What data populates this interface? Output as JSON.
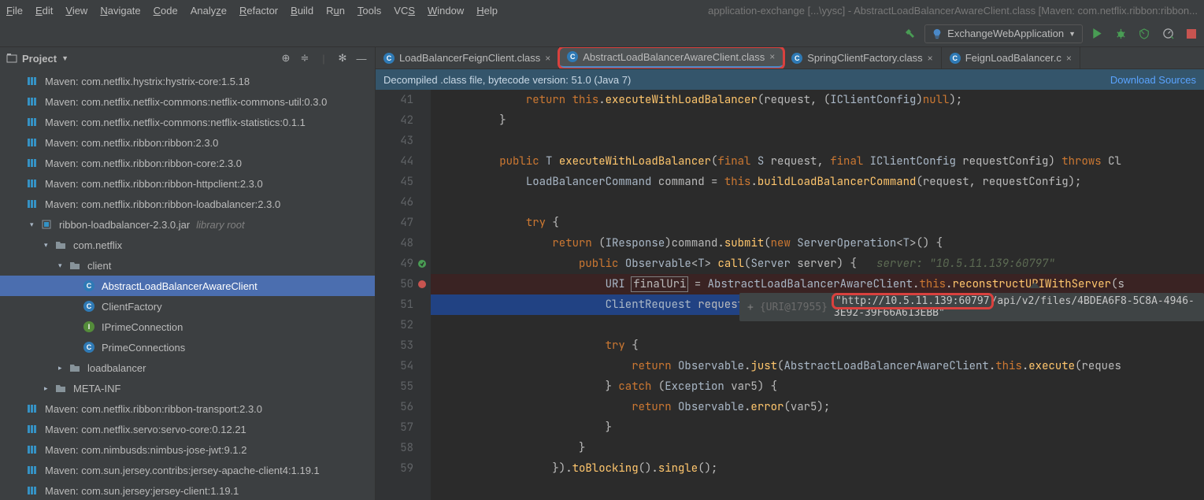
{
  "menubar": {
    "items": [
      "File",
      "Edit",
      "View",
      "Navigate",
      "Code",
      "Analyze",
      "Refactor",
      "Build",
      "Run",
      "Tools",
      "VCS",
      "Window",
      "Help"
    ],
    "title": "application-exchange [...\\yysc] - AbstractLoadBalancerAwareClient.class [Maven: com.netflix.ribbon:ribbon..."
  },
  "runconfig": {
    "label": "ExchangeWebApplication"
  },
  "sidebar": {
    "title": "Project",
    "items": [
      {
        "d": 0,
        "icon": "lib",
        "label": "Maven: com.netflix.hystrix:hystrix-core:1.5.18"
      },
      {
        "d": 0,
        "icon": "lib",
        "label": "Maven: com.netflix.netflix-commons:netflix-commons-util:0.3.0"
      },
      {
        "d": 0,
        "icon": "lib",
        "label": "Maven: com.netflix.netflix-commons:netflix-statistics:0.1.1"
      },
      {
        "d": 0,
        "icon": "lib",
        "label": "Maven: com.netflix.ribbon:ribbon:2.3.0"
      },
      {
        "d": 0,
        "icon": "lib",
        "label": "Maven: com.netflix.ribbon:ribbon-core:2.3.0"
      },
      {
        "d": 0,
        "icon": "lib",
        "label": "Maven: com.netflix.ribbon:ribbon-httpclient:2.3.0"
      },
      {
        "d": 0,
        "icon": "lib",
        "label": "Maven: com.netflix.ribbon:ribbon-loadbalancer:2.3.0"
      },
      {
        "d": 1,
        "icon": "jar",
        "exp": "open",
        "label": "ribbon-loadbalancer-2.3.0.jar",
        "suffix": "library root"
      },
      {
        "d": 2,
        "icon": "folder",
        "exp": "open",
        "label": "com.netflix"
      },
      {
        "d": 3,
        "icon": "folder",
        "exp": "open",
        "label": "client"
      },
      {
        "d": 4,
        "icon": "class",
        "label": "AbstractLoadBalancerAwareClient",
        "selected": true
      },
      {
        "d": 4,
        "icon": "class",
        "label": "ClientFactory"
      },
      {
        "d": 4,
        "icon": "interface",
        "label": "IPrimeConnection"
      },
      {
        "d": 4,
        "icon": "class",
        "label": "PrimeConnections"
      },
      {
        "d": 3,
        "icon": "folder",
        "exp": "closed",
        "label": "loadbalancer"
      },
      {
        "d": 2,
        "icon": "folder",
        "exp": "closed",
        "label": "META-INF"
      },
      {
        "d": 0,
        "icon": "lib",
        "label": "Maven: com.netflix.ribbon:ribbon-transport:2.3.0"
      },
      {
        "d": 0,
        "icon": "lib",
        "label": "Maven: com.netflix.servo:servo-core:0.12.21"
      },
      {
        "d": 0,
        "icon": "lib",
        "label": "Maven: com.nimbusds:nimbus-jose-jwt:9.1.2"
      },
      {
        "d": 0,
        "icon": "lib",
        "label": "Maven: com.sun.jersey.contribs:jersey-apache-client4:1.19.1"
      },
      {
        "d": 0,
        "icon": "lib",
        "label": "Maven: com.sun.jersey:jersey-client:1.19.1"
      }
    ]
  },
  "tabs": [
    {
      "label": "LoadBalancerFeignClient.class",
      "active": false
    },
    {
      "label": "AbstractLoadBalancerAwareClient.class",
      "active": true,
      "redbox": true
    },
    {
      "label": "SpringClientFactory.class",
      "active": false
    },
    {
      "label": "FeignLoadBalancer.c",
      "active": false
    }
  ],
  "bytecode_bar": {
    "text": "Decompiled .class file, bytecode version: 51.0 (Java 7)",
    "link": "Download Sources"
  },
  "line_start": 41,
  "line_end": 59,
  "code_lines": {
    "l41": {
      "t": "            return this.executeWithLoadBalancer(request, (IClientConfig)null);"
    },
    "l42": {
      "t": "        }"
    },
    "l43": {
      "t": ""
    },
    "l44": {
      "t": "        public T executeWithLoadBalancer(final S request, final IClientConfig requestConfig) throws Cl"
    },
    "l45": {
      "t": "            LoadBalancerCommand command = this.buildLoadBalancerCommand(request, requestConfig);"
    },
    "l46": {
      "t": ""
    },
    "l47": {
      "t": "            try {"
    },
    "l48": {
      "t": "                return (IResponse)command.submit(new ServerOperation<T>() {"
    },
    "l49": {
      "t": "                    public Observable<T> call(Server server) {   server: \"10.5.11.139:60797\""
    },
    "l50": {
      "t": "                        URI finalUri = AbstractLoadBalancerAwareClient.this.reconstructURIWithServer(s"
    },
    "l51": {
      "t": "                        ClientRequest requestForServer = request.replaceUri(finalUri);   request: Feign"
    },
    "l52": {
      "t": ""
    },
    "l53": {
      "t": "                        try {"
    },
    "l54": {
      "t": "                            return Observable.just(AbstractLoadBalancerAwareClient.this.execute(reques"
    },
    "l55": {
      "t": "                        } catch (Exception var5) {"
    },
    "l56": {
      "t": "                            return Observable.error(var5);"
    },
    "l57": {
      "t": "                        }"
    },
    "l58": {
      "t": "                    }"
    },
    "l59": {
      "t": "                }).toBlocking().single();"
    }
  },
  "debug": {
    "tag": "{URI@17955}",
    "value": "\"http://10.5.11.139:60797/api/v2/files/4BDEA6F8-5C8A-4946-3E92-39F66A613EBB\"",
    "prefix_boxed": "\"http://10.5.11.139:60797",
    "suffix": "/api/v2/files/4BDEA6F8-5C8A-4946-3E92-39F66A613EBB\""
  }
}
